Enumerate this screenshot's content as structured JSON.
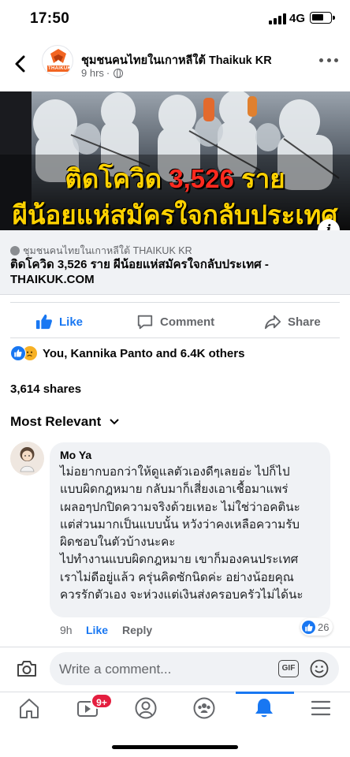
{
  "status_bar": {
    "time": "17:50",
    "network": "4G"
  },
  "post": {
    "page_name": "ชุมชนคนไทยในเกาหลีใต้ Thaikuk KR",
    "time": "9 hrs",
    "meta_sep": "·",
    "logo_text": "THAIKUK",
    "image": {
      "line1_prefix": "ติดโควิด ",
      "line1_number": "3,526",
      "line1_suffix": " ราย",
      "line2": "ผีน้อยแห่สมัครใจกลับประเทศ"
    },
    "link": {
      "source": "ชุมชนคนไทยในเกาหลีใต้ THAIKUK KR",
      "title": "ติดโควิด 3,526 ราย ผีน้อยแห่สมัครใจกลับประเทศ - THAIKUK.COM"
    },
    "actions": {
      "like": "Like",
      "comment": "Comment",
      "share": "Share"
    },
    "reactions_text": "You, Kannika Panto and 6.4K others",
    "shares_text": "3,614 shares"
  },
  "comments_section": {
    "sort_label": "Most Relevant",
    "comment": {
      "author": "Mo Ya",
      "lines": [
        "ไม่อยากบอกว่าให้ดูแลตัวเองดีๆเลยอ่ะ ไปก็ไป",
        "แบบผิดกฎหมาย กลับมาก็เสี่ยงเอาเชื้อมาแพร่",
        "เผลอๆปกปิดความจริงด้วยเหอะ ไม่ใช่ว่าอคตินะ",
        "แต่ส่วนมากเป็นแบบนั้น  หวังว่าคงเหลือความรับ",
        "ผิดชอบในตัวบ้างนะคะ",
        "ไปทำงานแบบผิดกฎหมาย เขาก็มองคนประเทศ",
        "เราไม่ดีอยู่แล้ว ครุ่นคิดซักนิดค่ะ อย่างน้อยคุณ",
        "ควรรักตัวเอง จะห่วงแต่เงินส่งครอบครัวไม่ได้นะ"
      ],
      "time": "9h",
      "like": "Like",
      "reply": "Reply",
      "reaction_count": "26"
    }
  },
  "composer": {
    "placeholder": "Write a comment...",
    "gif_label": "GIF"
  },
  "nav": {
    "watch_badge": "9+"
  },
  "colors": {
    "brand_blue": "#1877f2",
    "badge_red": "#e41e3f",
    "headline_yellow": "#ffd200",
    "headline_red": "#ff2a1f"
  }
}
